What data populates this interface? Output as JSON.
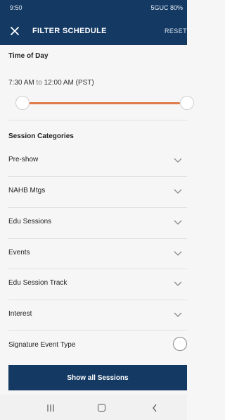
{
  "status_bar": {
    "time": "9:50",
    "indicators": "5GUC 80%"
  },
  "header": {
    "title": "FILTER SCHEDULE",
    "reset_label": "RESET"
  },
  "time_of_day": {
    "section_title": "Time of Day",
    "start": "7:30 AM",
    "connector": "to",
    "end": "12:00 AM (PST)",
    "range_fraction": [
      0,
      1
    ]
  },
  "session_categories": {
    "section_title": "Session Categories",
    "items": [
      {
        "label": "Pre-show"
      },
      {
        "label": "NAHB Mtgs"
      },
      {
        "label": "Edu Sessions"
      },
      {
        "label": "Events"
      },
      {
        "label": "Edu Session Track"
      },
      {
        "label": "Interest"
      }
    ]
  },
  "signature_event": {
    "label": "Signature Event Type"
  },
  "actions": {
    "show_all": "Show all Sessions"
  },
  "colors": {
    "header_bg": "#143a64",
    "slider_accent": "#e07b4b"
  }
}
